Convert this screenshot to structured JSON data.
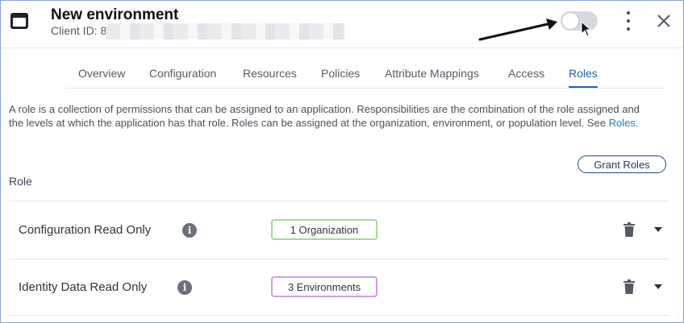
{
  "header": {
    "title": "New environment",
    "client_id_label": "Client ID: 8",
    "icons": [
      "app-icon",
      "toggle",
      "more-vertical-icon",
      "close-icon"
    ]
  },
  "tabs": [
    {
      "label": "Overview",
      "active": false
    },
    {
      "label": "Configuration",
      "active": false
    },
    {
      "label": "Resources",
      "active": false
    },
    {
      "label": "Policies",
      "active": false
    },
    {
      "label": "Attribute Mappings",
      "active": false
    },
    {
      "label": "Access",
      "active": false
    },
    {
      "label": "Roles",
      "active": true
    }
  ],
  "description": {
    "text": "A role is a collection of permissions that can be assigned to an application. Responsibilities are the combination of the role assigned and the levels at which the application has that role. Roles can be assigned at the organization, environment, or population level. See ",
    "link": "Roles",
    "suffix": "."
  },
  "grant_roles_label": "Grant Roles",
  "role_column_label": "Role",
  "roles": [
    {
      "name": "Configuration Read Only",
      "scope": "1 Organization",
      "scope_color": "#9ee08a"
    },
    {
      "name": "Identity Data Read Only",
      "scope": "3 Environments",
      "scope_color": "#d79be2"
    }
  ],
  "colors": {
    "accent": "#2c5fa8",
    "link": "#2c76c9",
    "frame_border": "#8aa0d8"
  }
}
